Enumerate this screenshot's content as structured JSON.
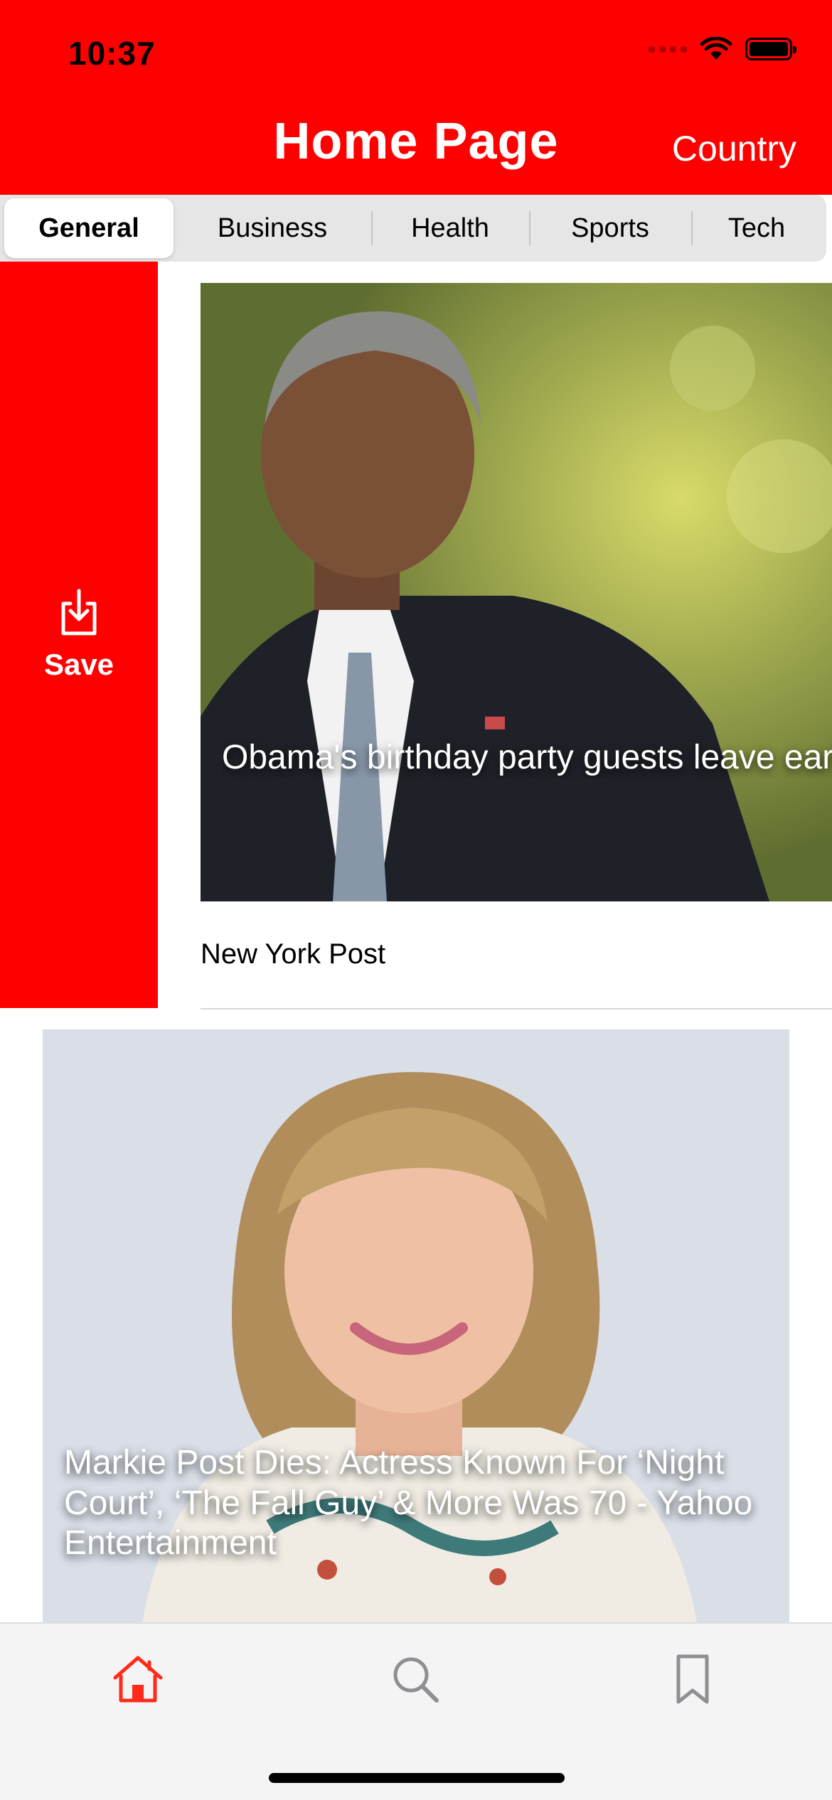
{
  "status_bar": {
    "time": "10:37"
  },
  "nav": {
    "title": "Home Page",
    "country_button": "Country"
  },
  "categories": {
    "items": [
      "General",
      "Business",
      "Health",
      "Sports",
      "Tech"
    ],
    "selected": "General"
  },
  "swipe_action": {
    "label": "Save",
    "icon": "save-download-icon",
    "color": "#ff0000"
  },
  "articles": [
    {
      "headline": "Obama's birthday party guests leave early because of traffic 'sh-- show' - Fox News",
      "source": "New York Post",
      "image": "photo-man-in-suit"
    },
    {
      "headline": "Markie Post Dies: Actress Known For ‘Night Court’, ‘The Fall Guy’ & More Was 70 - Yahoo Entertainment",
      "image": "photo-woman-smiling"
    }
  ],
  "tab_bar": {
    "items": [
      {
        "name": "home",
        "icon": "home-icon",
        "active": true
      },
      {
        "name": "search",
        "icon": "search-icon",
        "active": false
      },
      {
        "name": "bookmarks",
        "icon": "bookmark-icon",
        "active": false
      }
    ],
    "active_color": "#ff2a1a",
    "inactive_color": "#8e8e93"
  },
  "colors": {
    "brand": "#ff0000",
    "text_on_brand": "#ffffff"
  }
}
